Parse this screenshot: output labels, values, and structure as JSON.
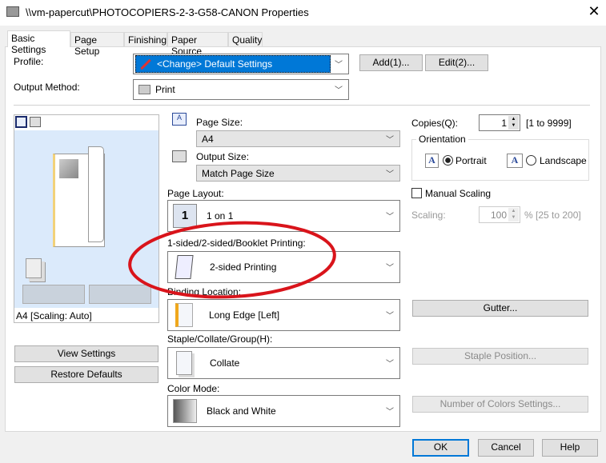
{
  "window": {
    "title": "\\\\vm-papercut\\PHOTOCOPIERS-2-3-G58-CANON Properties",
    "close": "✕"
  },
  "tabs": [
    {
      "label": "Basic Settings",
      "active": true
    },
    {
      "label": "Page Setup"
    },
    {
      "label": "Finishing"
    },
    {
      "label": "Paper Source"
    },
    {
      "label": "Quality"
    }
  ],
  "profile": {
    "label": "Profile:",
    "value": "<Change> Default Settings",
    "add": "Add(1)...",
    "edit": "Edit(2)..."
  },
  "output_method": {
    "label": "Output Method:",
    "value": "Print"
  },
  "preview": {
    "status": "A4 [Scaling: Auto]",
    "view_settings": "View Settings",
    "restore_defaults": "Restore Defaults"
  },
  "page_size": {
    "label": "Page Size:",
    "value": "A4"
  },
  "output_size": {
    "label": "Output Size:",
    "value": "Match Page Size"
  },
  "page_layout": {
    "label": "Page Layout:",
    "value": "1 on 1",
    "icon_text": "1"
  },
  "sided": {
    "label": "1-sided/2-sided/Booklet Printing:",
    "value": "2-sided Printing"
  },
  "binding": {
    "label": "Binding Location:",
    "value": "Long Edge [Left]"
  },
  "staple": {
    "label": "Staple/Collate/Group(H):",
    "value": "Collate"
  },
  "color_mode": {
    "label": "Color Mode:",
    "value": "Black and White"
  },
  "copies": {
    "label": "Copies(Q):",
    "value": "1",
    "range": "[1 to 9999]"
  },
  "orientation": {
    "label": "Orientation",
    "portrait": "Portrait",
    "landscape": "Landscape",
    "selected": "Portrait"
  },
  "manual_scaling": {
    "label": "Manual Scaling",
    "checked": false
  },
  "scaling": {
    "label": "Scaling:",
    "value": "100",
    "range": "% [25 to 200]"
  },
  "buttons": {
    "gutter": "Gutter...",
    "staple_position": "Staple Position...",
    "colors": "Number of Colors Settings...",
    "ok": "OK",
    "cancel": "Cancel",
    "help": "Help"
  },
  "colors": {
    "selection": "#0078d7",
    "annotation": "#d9141b",
    "preview_bg": "#dbeafb"
  }
}
